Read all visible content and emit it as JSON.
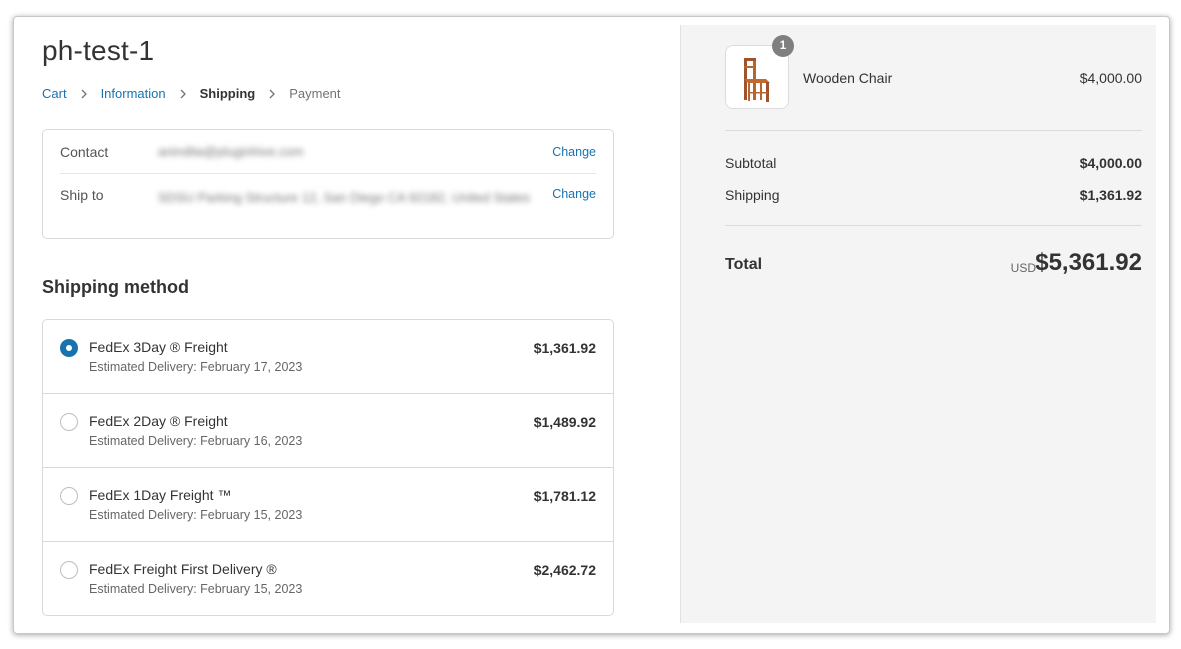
{
  "store": {
    "title": "ph-test-1"
  },
  "breadcrumb": [
    {
      "label": "Cart"
    },
    {
      "label": "Information"
    },
    {
      "label": "Shipping"
    },
    {
      "label": "Payment"
    }
  ],
  "review": {
    "contact": {
      "label": "Contact",
      "value": "anindita@pluginhive.com",
      "change": "Change"
    },
    "ship_to": {
      "label": "Ship to",
      "value": "SDSU Parking Structure 12, San Diego CA 92182, United States",
      "change": "Change"
    }
  },
  "shipping_method": {
    "title": "Shipping method",
    "options": [
      {
        "name": "FedEx 3Day ® Freight",
        "eta": "Estimated Delivery: February 17, 2023",
        "price": "$1,361.92",
        "selected": true
      },
      {
        "name": "FedEx 2Day ® Freight",
        "eta": "Estimated Delivery: February 16, 2023",
        "price": "$1,489.92",
        "selected": false
      },
      {
        "name": "FedEx 1Day Freight ™",
        "eta": "Estimated Delivery: February 15, 2023",
        "price": "$1,781.12",
        "selected": false
      },
      {
        "name": "FedEx Freight First Delivery ®",
        "eta": "Estimated Delivery: February 15, 2023",
        "price": "$2,462.72",
        "selected": false
      }
    ]
  },
  "summary": {
    "product": {
      "name": "Wooden Chair",
      "price": "$4,000.00",
      "quantity": "1",
      "image_icon": "chair-icon"
    },
    "subtotal": {
      "label": "Subtotal",
      "value": "$4,000.00"
    },
    "shipping": {
      "label": "Shipping",
      "value": "$1,361.92"
    },
    "total": {
      "label": "Total",
      "currency": "USD",
      "value": "$5,361.92"
    }
  },
  "colors": {
    "accent": "#1773b0",
    "summary_bg": "#f4f4f4",
    "badge": "#7f7f7f"
  }
}
